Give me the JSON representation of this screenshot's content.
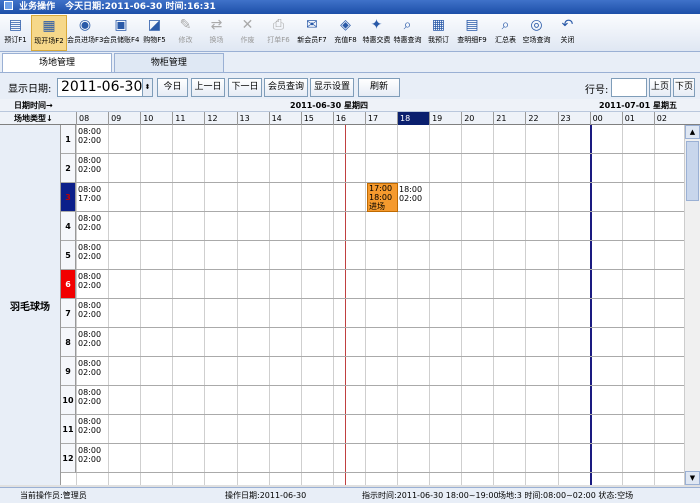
{
  "window": {
    "title": "业务操作",
    "today_date": "今天日期:2011-06-30",
    "time": "时间:16:31"
  },
  "toolbar": [
    {
      "label": "预订F1",
      "icon": "document-icon"
    },
    {
      "label": "现开场F2",
      "icon": "open-venue-icon",
      "active": true
    },
    {
      "label": "会员进场F3",
      "icon": "member-enter-icon"
    },
    {
      "label": "会员储账F4",
      "icon": "clipboard-icon"
    },
    {
      "label": "购物F5",
      "icon": "shopping-icon"
    },
    {
      "label": "修改",
      "icon": "edit-icon",
      "disabled": true
    },
    {
      "label": "换场",
      "icon": "swap-icon",
      "disabled": true
    },
    {
      "label": "作废",
      "icon": "cancel-icon",
      "disabled": true
    },
    {
      "label": "打单F6",
      "icon": "print-icon",
      "disabled": true
    },
    {
      "label": "新会员F7",
      "icon": "mail-icon"
    },
    {
      "label": "充值F8",
      "icon": "recharge-icon"
    },
    {
      "label": "特惠交费",
      "icon": "discount-pay-icon"
    },
    {
      "label": "特惠查询",
      "icon": "discount-query-icon"
    },
    {
      "label": "我预订",
      "icon": "calendar-icon"
    },
    {
      "label": "查明细F9",
      "icon": "detail-icon"
    },
    {
      "label": "汇总表",
      "icon": "summary-icon"
    },
    {
      "label": "空场查询",
      "icon": "empty-query-icon"
    },
    {
      "label": "关闭",
      "icon": "close-icon"
    }
  ],
  "tabs": [
    {
      "label": "场地管理",
      "selected": true
    },
    {
      "label": "物柜管理",
      "selected": false
    }
  ],
  "filter": {
    "display_date_label": "显示日期:",
    "date_value": "2011-06-30",
    "today_btn": "今日",
    "prev_btn": "上一日",
    "next_btn": "下一日",
    "member_query_btn": "会员查询",
    "display_settings_btn": "显示设置",
    "refresh_btn": "刷新",
    "row_label": "行号:",
    "prev_page_btn": "上页",
    "next_page_btn": "下页"
  },
  "grid": {
    "date_time_label": "日期时间→",
    "venue_type_label": "场地类型↓",
    "day1_label": "2011-06-30  星期四",
    "day2_label": "2011-07-01  星期五",
    "hours": [
      "08",
      "09",
      "10",
      "11",
      "12",
      "13",
      "14",
      "15",
      "16",
      "17",
      "18",
      "19",
      "20",
      "21",
      "22",
      "23",
      "00",
      "01",
      "02"
    ],
    "highlight_hour": "18",
    "venue_name": "羽毛球场",
    "courts": [
      {
        "num": "1",
        "start": "08:00",
        "end": "02:00",
        "state": "normal"
      },
      {
        "num": "2",
        "start": "08:00",
        "end": "02:00",
        "state": "normal"
      },
      {
        "num": "3",
        "start": "08:00",
        "end": "17:00",
        "state": "blue"
      },
      {
        "num": "4",
        "start": "08:00",
        "end": "02:00",
        "state": "normal"
      },
      {
        "num": "5",
        "start": "08:00",
        "end": "02:00",
        "state": "normal"
      },
      {
        "num": "6",
        "start": "08:00",
        "end": "02:00",
        "state": "red"
      },
      {
        "num": "7",
        "start": "08:00",
        "end": "02:00",
        "state": "normal"
      },
      {
        "num": "8",
        "start": "08:00",
        "end": "02:00",
        "state": "normal"
      },
      {
        "num": "9",
        "start": "08:00",
        "end": "02:00",
        "state": "normal"
      },
      {
        "num": "10",
        "start": "08:00",
        "end": "02:00",
        "state": "normal"
      },
      {
        "num": "11",
        "start": "08:00",
        "end": "02:00",
        "state": "normal"
      },
      {
        "num": "12",
        "start": "08:00",
        "end": "02:00",
        "state": "normal"
      }
    ],
    "booking": {
      "line1": "17:00",
      "line2": "18:00",
      "line3": "进场",
      "after_start": "18:00",
      "after_end": "02:00"
    }
  },
  "status": {
    "operator": "当前操作员:管理员",
    "op_date": "操作日期:2011-06-30",
    "period": "指示时间:2011-06-30 18:00~19:00",
    "court_info": "场地:3 时间:08:00~02:00 状态:空场"
  }
}
